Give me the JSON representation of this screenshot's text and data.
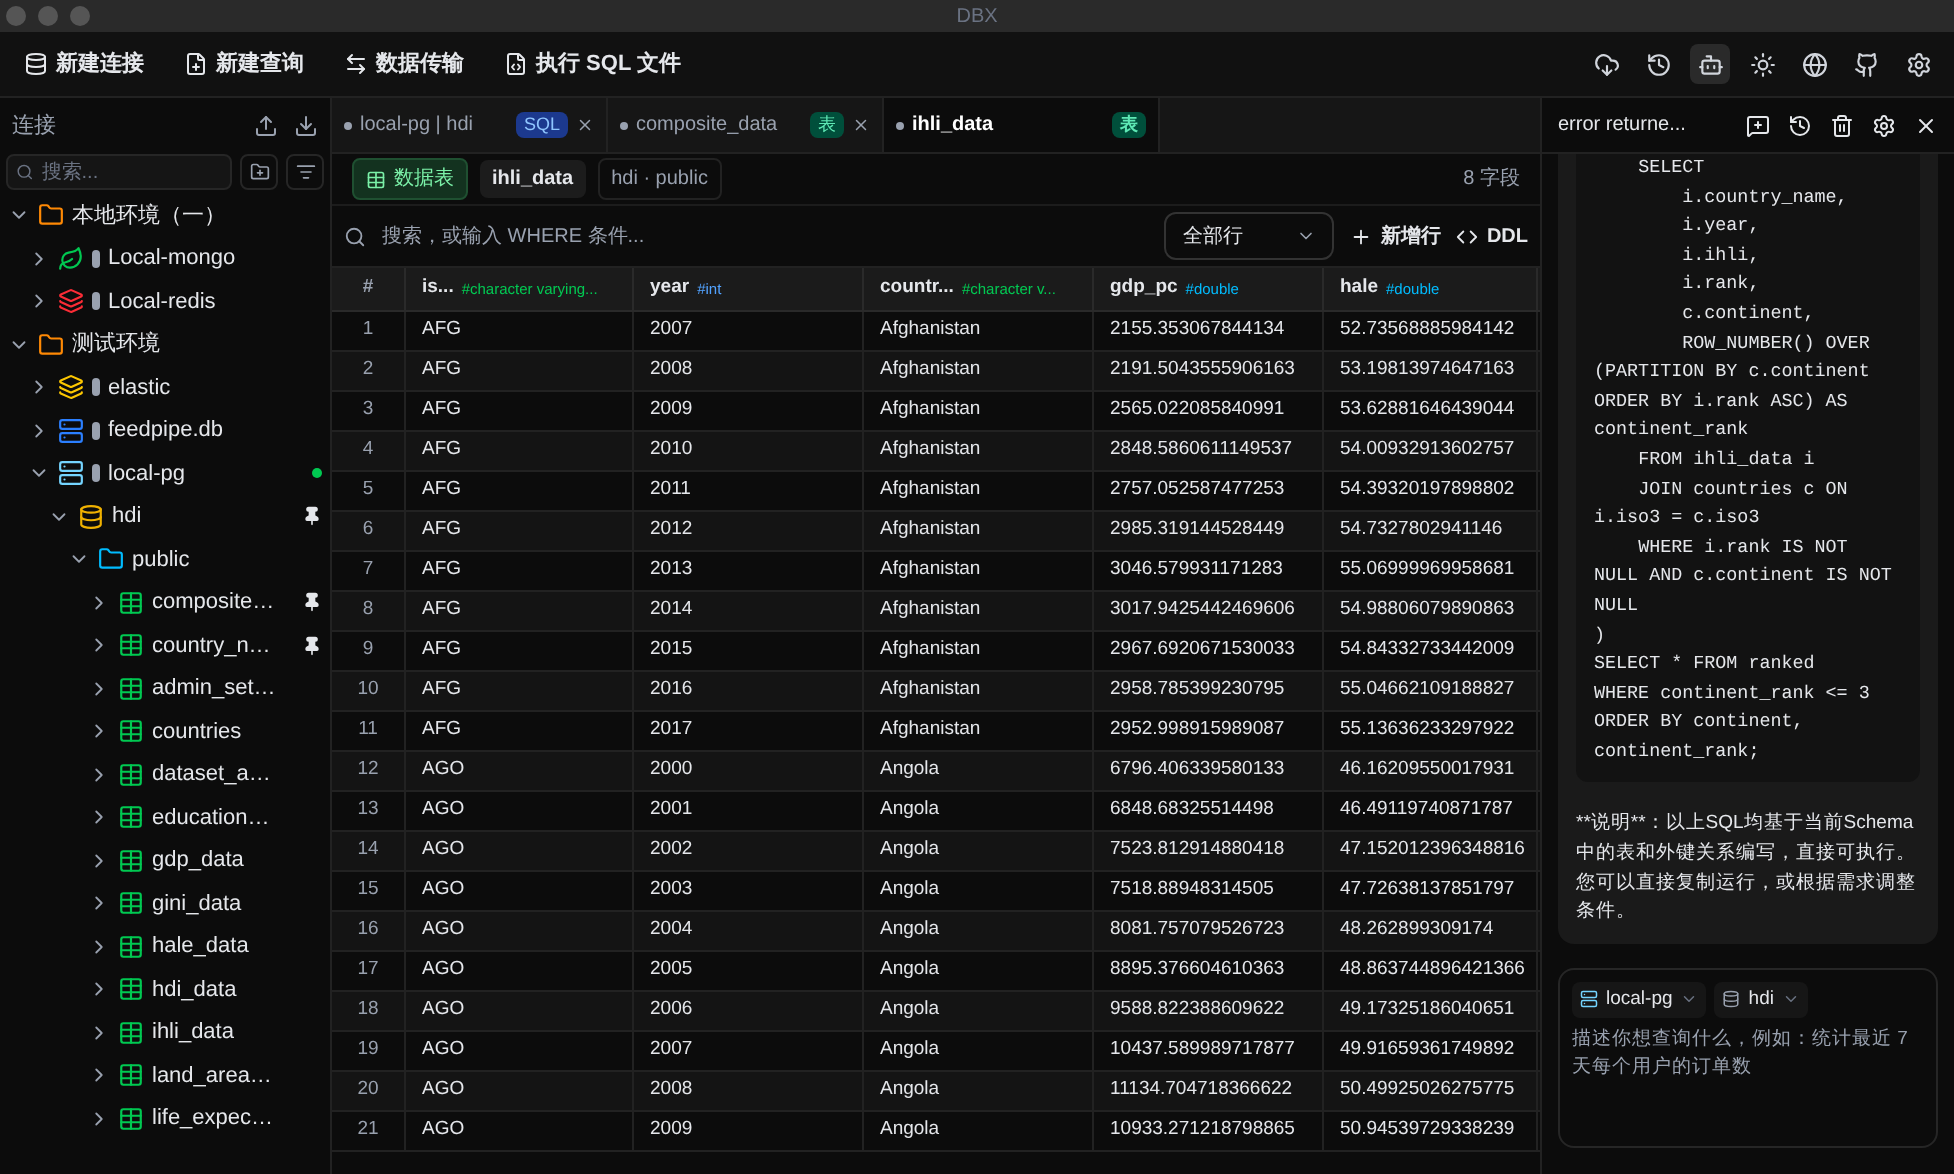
{
  "window": {
    "title": "DBX"
  },
  "toolbar": {
    "buttons": [
      {
        "kind": "conn",
        "label": "新建连接"
      },
      {
        "kind": "query",
        "label": "新建查询"
      },
      {
        "kind": "transfer",
        "label": "数据传输"
      },
      {
        "kind": "file",
        "label": "执行 SQL 文件"
      }
    ],
    "icons": [
      {
        "kind": "cloud",
        "selected": false
      },
      {
        "kind": "history",
        "selected": false
      },
      {
        "kind": "bot",
        "selected": true
      },
      {
        "kind": "sun",
        "selected": false
      },
      {
        "kind": "globe",
        "selected": false
      },
      {
        "kind": "github",
        "selected": false
      },
      {
        "kind": "settings",
        "selected": false
      }
    ]
  },
  "sidebar": {
    "title": "连接",
    "search": {
      "placeholder": "搜索..."
    },
    "tree": [
      {
        "kind": "folder",
        "label": "本地环境（一）",
        "expanded": true,
        "children": [
          {
            "kind": "mongo",
            "label": "Local-mongo",
            "expanded": false
          },
          {
            "kind": "redis",
            "label": "Local-redis",
            "expanded": false
          }
        ]
      },
      {
        "kind": "folder",
        "label": "测试环境",
        "expanded": true,
        "children": [
          {
            "kind": "elastic",
            "label": "elastic",
            "expanded": false
          },
          {
            "kind": "sqlite",
            "label": "feedpipe.db",
            "expanded": false
          },
          {
            "kind": "pg",
            "label": "local-pg",
            "expanded": true,
            "connected": true,
            "children": [
              {
                "kind": "db",
                "label": "hdi",
                "expanded": true,
                "pinned": true,
                "children": [
                  {
                    "kind": "schema",
                    "label": "public",
                    "expanded": true,
                    "children": [
                      {
                        "kind": "table",
                        "label": "composite…",
                        "expanded": false,
                        "pinned": true
                      },
                      {
                        "kind": "table",
                        "label": "country_n…",
                        "expanded": false,
                        "pinned": true
                      },
                      {
                        "kind": "table",
                        "label": "admin_set…",
                        "expanded": false
                      },
                      {
                        "kind": "table",
                        "label": "countries",
                        "expanded": false
                      },
                      {
                        "kind": "table",
                        "label": "dataset_a…",
                        "expanded": false
                      },
                      {
                        "kind": "table",
                        "label": "education…",
                        "expanded": false
                      },
                      {
                        "kind": "table",
                        "label": "gdp_data",
                        "expanded": false
                      },
                      {
                        "kind": "table",
                        "label": "gini_data",
                        "expanded": false
                      },
                      {
                        "kind": "table",
                        "label": "hale_data",
                        "expanded": false
                      },
                      {
                        "kind": "table",
                        "label": "hdi_data",
                        "expanded": false
                      },
                      {
                        "kind": "table",
                        "label": "ihli_data",
                        "expanded": false
                      },
                      {
                        "kind": "table",
                        "label": "land_area…",
                        "expanded": false
                      },
                      {
                        "kind": "table",
                        "label": "life_expec…",
                        "expanded": false
                      }
                    ]
                  }
                ]
              }
            ]
          }
        ]
      }
    ]
  },
  "tabs": [
    {
      "label": "local-pg | hdi",
      "badge": "SQL",
      "kind": "sql",
      "selected": false
    },
    {
      "label": "composite_data",
      "badge": "表",
      "kind": "table",
      "selected": false
    },
    {
      "label": "ihli_data",
      "badge": "表",
      "kind": "table",
      "selected": true
    }
  ],
  "table_header": {
    "view": "数据表",
    "table": "ihli_data",
    "path": "hdi · public",
    "field_count": "8 字段"
  },
  "filter": {
    "placeholder": "搜索，或输入 WHERE 条件...",
    "rows_select": "全部行",
    "add_row": "新增行",
    "ddl": "DDL"
  },
  "table": {
    "columns": [
      {
        "name": "#"
      },
      {
        "name": "is...",
        "type": "#character varying..."
      },
      {
        "name": "year",
        "type": "#int"
      },
      {
        "name": "countr...",
        "type": "#character v..."
      },
      {
        "name": "gdp_pc",
        "type": "#double"
      },
      {
        "name": "hale",
        "type": "#double"
      }
    ],
    "rows": [
      [
        "1",
        "AFG",
        "2007",
        "Afghanistan",
        "2155.353067844134",
        "52.73568885984142"
      ],
      [
        "2",
        "AFG",
        "2008",
        "Afghanistan",
        "2191.5043555906163",
        "53.19813974647163"
      ],
      [
        "3",
        "AFG",
        "2009",
        "Afghanistan",
        "2565.022085840991",
        "53.62881646439044"
      ],
      [
        "4",
        "AFG",
        "2010",
        "Afghanistan",
        "2848.5860611149537",
        "54.00932913602757"
      ],
      [
        "5",
        "AFG",
        "2011",
        "Afghanistan",
        "2757.052587477253",
        "54.39320197898802"
      ],
      [
        "6",
        "AFG",
        "2012",
        "Afghanistan",
        "2985.319144528449",
        "54.7327802941146"
      ],
      [
        "7",
        "AFG",
        "2013",
        "Afghanistan",
        "3046.579931171283",
        "55.06999969958681"
      ],
      [
        "8",
        "AFG",
        "2014",
        "Afghanistan",
        "3017.9425442469606",
        "54.98806079890863"
      ],
      [
        "9",
        "AFG",
        "2015",
        "Afghanistan",
        "2967.6920671530033",
        "54.84332733442009"
      ],
      [
        "10",
        "AFG",
        "2016",
        "Afghanistan",
        "2958.785399230795",
        "55.04662109188827"
      ],
      [
        "11",
        "AFG",
        "2017",
        "Afghanistan",
        "2952.998915989087",
        "55.13636233297922"
      ],
      [
        "12",
        "AGO",
        "2000",
        "Angola",
        "6796.406339580133",
        "46.16209550017931"
      ],
      [
        "13",
        "AGO",
        "2001",
        "Angola",
        "6848.68325514498",
        "46.49119740871787"
      ],
      [
        "14",
        "AGO",
        "2002",
        "Angola",
        "7523.812914880418",
        "47.152012396348816"
      ],
      [
        "15",
        "AGO",
        "2003",
        "Angola",
        "7518.88948314505",
        "47.72638137851797"
      ],
      [
        "16",
        "AGO",
        "2004",
        "Angola",
        "8081.757079526723",
        "48.262899309174"
      ],
      [
        "17",
        "AGO",
        "2005",
        "Angola",
        "8895.376604610363",
        "48.863744896421366"
      ],
      [
        "18",
        "AGO",
        "2006",
        "Angola",
        "9588.822388609622",
        "49.17325186040651"
      ],
      [
        "19",
        "AGO",
        "2007",
        "Angola",
        "10437.589989717877",
        "49.91659361749892"
      ],
      [
        "20",
        "AGO",
        "2008",
        "Angola",
        "11134.704718366622",
        "50.49925026275775"
      ],
      [
        "21",
        "AGO",
        "2009",
        "Angola",
        "10933.271218798865",
        "50.94539729338239"
      ]
    ]
  },
  "ai_panel": {
    "title": "error returne...",
    "code": "    SELECT\n        i.country_name,\n        i.year,\n        i.ihli,\n        i.rank,\n        c.continent,\n        ROW_NUMBER() OVER (PARTITION BY c.continent ORDER BY i.rank ASC) AS continent_rank\n    FROM ihli_data i\n    JOIN countries c ON i.iso3 = c.iso3\n    WHERE i.rank IS NOT NULL AND c.continent IS NOT NULL\n)\nSELECT * FROM ranked\nWHERE continent_rank <= 3\nORDER BY continent, continent_rank;",
    "note": "**说明**：以上SQL均基于当前Schema中的表和外键关系编写，直接可执行。您可以直接复制运行，或根据需求调整条件。",
    "connection": "local-pg",
    "database": "hdi",
    "input": {
      "placeholder": "描述你想查询什么，例如：统计最近 7 天每个用户的订单数"
    }
  }
}
